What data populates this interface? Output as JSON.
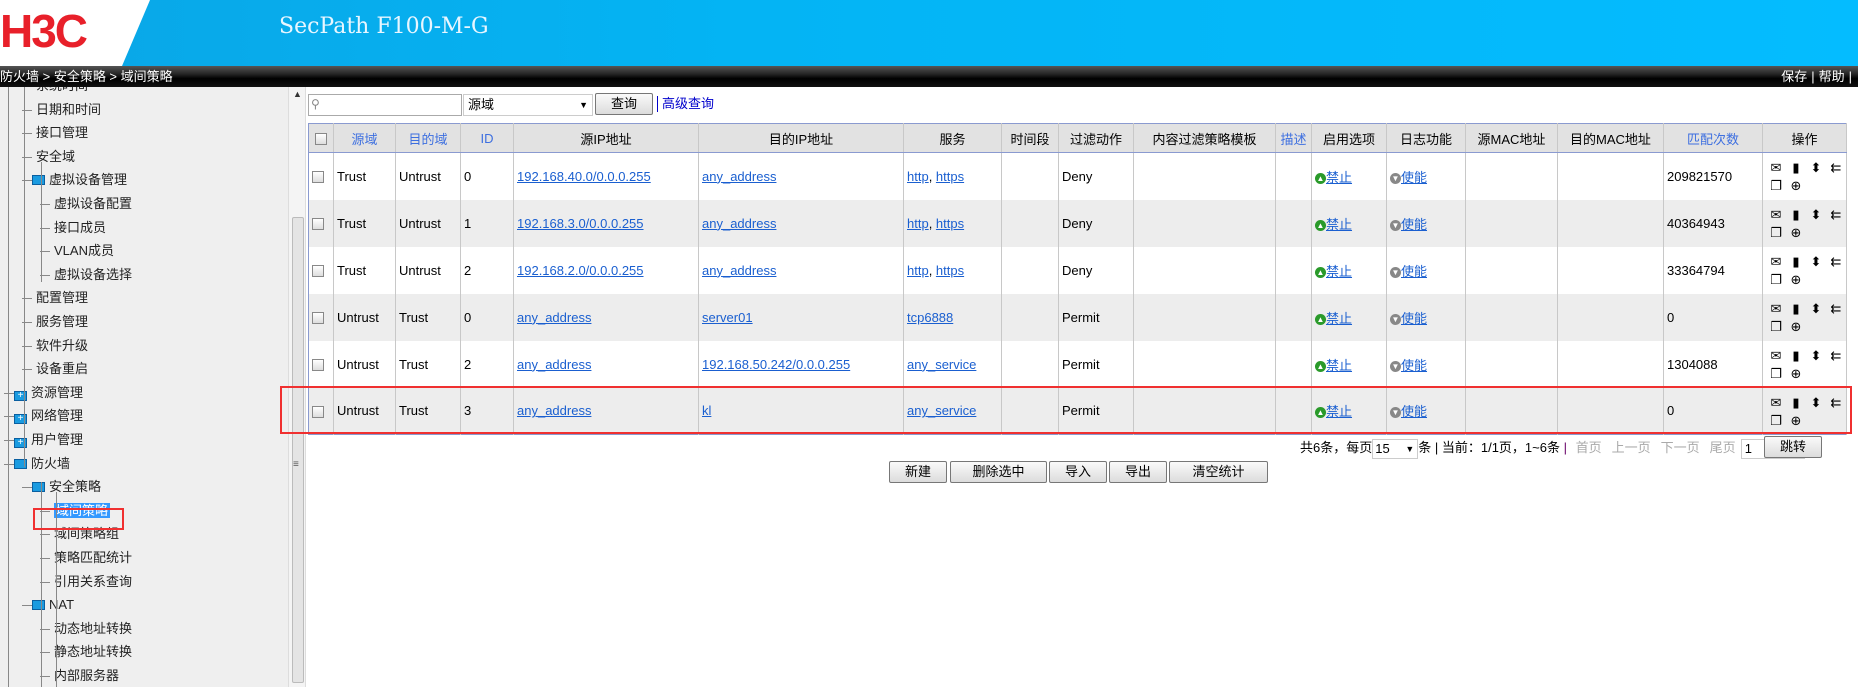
{
  "header": {
    "logo": "H3C",
    "product": "SecPath F100-M-G",
    "breadcrumb": "防火墙 > 安全策略 > 域间策略",
    "links": [
      "保存",
      "帮助"
    ]
  },
  "sidebar": {
    "items": [
      {
        "label": "系统时间",
        "level": 2
      },
      {
        "label": "日期和时间",
        "level": 2
      },
      {
        "label": "接口管理",
        "level": 2
      },
      {
        "label": "安全域",
        "level": 2
      },
      {
        "label": "虚拟设备管理",
        "level": 2,
        "folder": true
      },
      {
        "label": "虚拟设备配置",
        "level": 3
      },
      {
        "label": "接口成员",
        "level": 3
      },
      {
        "label": "VLAN成员",
        "level": 3
      },
      {
        "label": "虚拟设备选择",
        "level": 3
      },
      {
        "label": "配置管理",
        "level": 2
      },
      {
        "label": "服务管理",
        "level": 2
      },
      {
        "label": "软件升级",
        "level": 2
      },
      {
        "label": "设备重启",
        "level": 2
      },
      {
        "label": "资源管理",
        "level": 1,
        "folder": true,
        "collapsed": true
      },
      {
        "label": "网络管理",
        "level": 1,
        "folder": true,
        "collapsed": true
      },
      {
        "label": "用户管理",
        "level": 1,
        "folder": true,
        "collapsed": true
      },
      {
        "label": "防火墙",
        "level": 1,
        "folder": true
      },
      {
        "label": "安全策略",
        "level": 2,
        "folder": true
      },
      {
        "label": "域间策略",
        "level": 3,
        "selected": true
      },
      {
        "label": "域间策略组",
        "level": 3
      },
      {
        "label": "策略匹配统计",
        "level": 3
      },
      {
        "label": "引用关系查询",
        "level": 3
      },
      {
        "label": "NAT",
        "level": 2,
        "folder": true
      },
      {
        "label": "动态地址转换",
        "level": 3
      },
      {
        "label": "静态地址转换",
        "level": 3
      },
      {
        "label": "内部服务器",
        "level": 3
      }
    ]
  },
  "toolbar": {
    "search_value": "",
    "select_value": "源域",
    "query_button": "查询",
    "advanced_link": "高级查询"
  },
  "table": {
    "columns": [
      "",
      "源域",
      "目的域",
      "ID",
      "源IP地址",
      "目的IP地址",
      "服务",
      "时间段",
      "过滤动作",
      "内容过滤策略模板",
      "描述",
      "启用选项",
      "日志功能",
      "源MAC地址",
      "目的MAC地址",
      "匹配次数",
      "操作"
    ],
    "sortable": [
      1,
      2,
      3,
      10,
      15
    ],
    "rows": [
      {
        "src_zone": "Trust",
        "dst_zone": "Untrust",
        "id": "0",
        "src_ip": "192.168.40.0/0.0.0.255",
        "dst_ip": "any_address",
        "services": [
          "http",
          "https"
        ],
        "time": "",
        "action": "Deny",
        "template": "",
        "desc": "",
        "enable": "禁止",
        "log": "使能",
        "src_mac": "",
        "dst_mac": "",
        "matches": "209821570"
      },
      {
        "src_zone": "Trust",
        "dst_zone": "Untrust",
        "id": "1",
        "src_ip": "192.168.3.0/0.0.0.255",
        "dst_ip": "any_address",
        "services": [
          "http",
          "https"
        ],
        "time": "",
        "action": "Deny",
        "template": "",
        "desc": "",
        "enable": "禁止",
        "log": "使能",
        "src_mac": "",
        "dst_mac": "",
        "matches": "40364943"
      },
      {
        "src_zone": "Trust",
        "dst_zone": "Untrust",
        "id": "2",
        "src_ip": "192.168.2.0/0.0.0.255",
        "dst_ip": "any_address",
        "services": [
          "http",
          "https"
        ],
        "time": "",
        "action": "Deny",
        "template": "",
        "desc": "",
        "enable": "禁止",
        "log": "使能",
        "src_mac": "",
        "dst_mac": "",
        "matches": "33364794"
      },
      {
        "src_zone": "Untrust",
        "dst_zone": "Trust",
        "id": "0",
        "src_ip": "any_address",
        "dst_ip": "server01",
        "services": [
          "tcp6888"
        ],
        "time": "",
        "action": "Permit",
        "template": "",
        "desc": "",
        "enable": "禁止",
        "log": "使能",
        "src_mac": "",
        "dst_mac": "",
        "matches": "0"
      },
      {
        "src_zone": "Untrust",
        "dst_zone": "Trust",
        "id": "2",
        "src_ip": "any_address",
        "dst_ip": "192.168.50.242/0.0.0.255",
        "services": [
          "any_service"
        ],
        "time": "",
        "action": "Permit",
        "template": "",
        "desc": "",
        "enable": "禁止",
        "log": "使能",
        "src_mac": "",
        "dst_mac": "",
        "matches": "1304088"
      },
      {
        "src_zone": "Untrust",
        "dst_zone": "Trust",
        "id": "3",
        "src_ip": "any_address",
        "dst_ip": "kl",
        "services": [
          "any_service"
        ],
        "time": "",
        "action": "Permit",
        "template": "",
        "desc": "",
        "enable": "禁止",
        "log": "使能",
        "src_mac": "",
        "dst_mac": "",
        "matches": "0",
        "highlighted": true
      }
    ],
    "row_icons": [
      "edit-icon",
      "delete-icon",
      "move-icon",
      "insert-icon",
      "copy-icon",
      "view-icon"
    ]
  },
  "pager": {
    "total": "共6条，每页",
    "per_page": "15",
    "unit": "条",
    "current": "当前：1/1页，1~6条",
    "first": "首页",
    "prev": "上一页",
    "next": "下一页",
    "last": "尾页",
    "page_input": "1",
    "jump": "跳转"
  },
  "actions": [
    "新建",
    "删除选中",
    "导入",
    "导出",
    "清空统计"
  ],
  "colors": {
    "banner": "#04bcff",
    "logo": "#e8202a",
    "highlight": "#f03030",
    "link": "#1a5fd0",
    "selected": "#3399ff"
  }
}
